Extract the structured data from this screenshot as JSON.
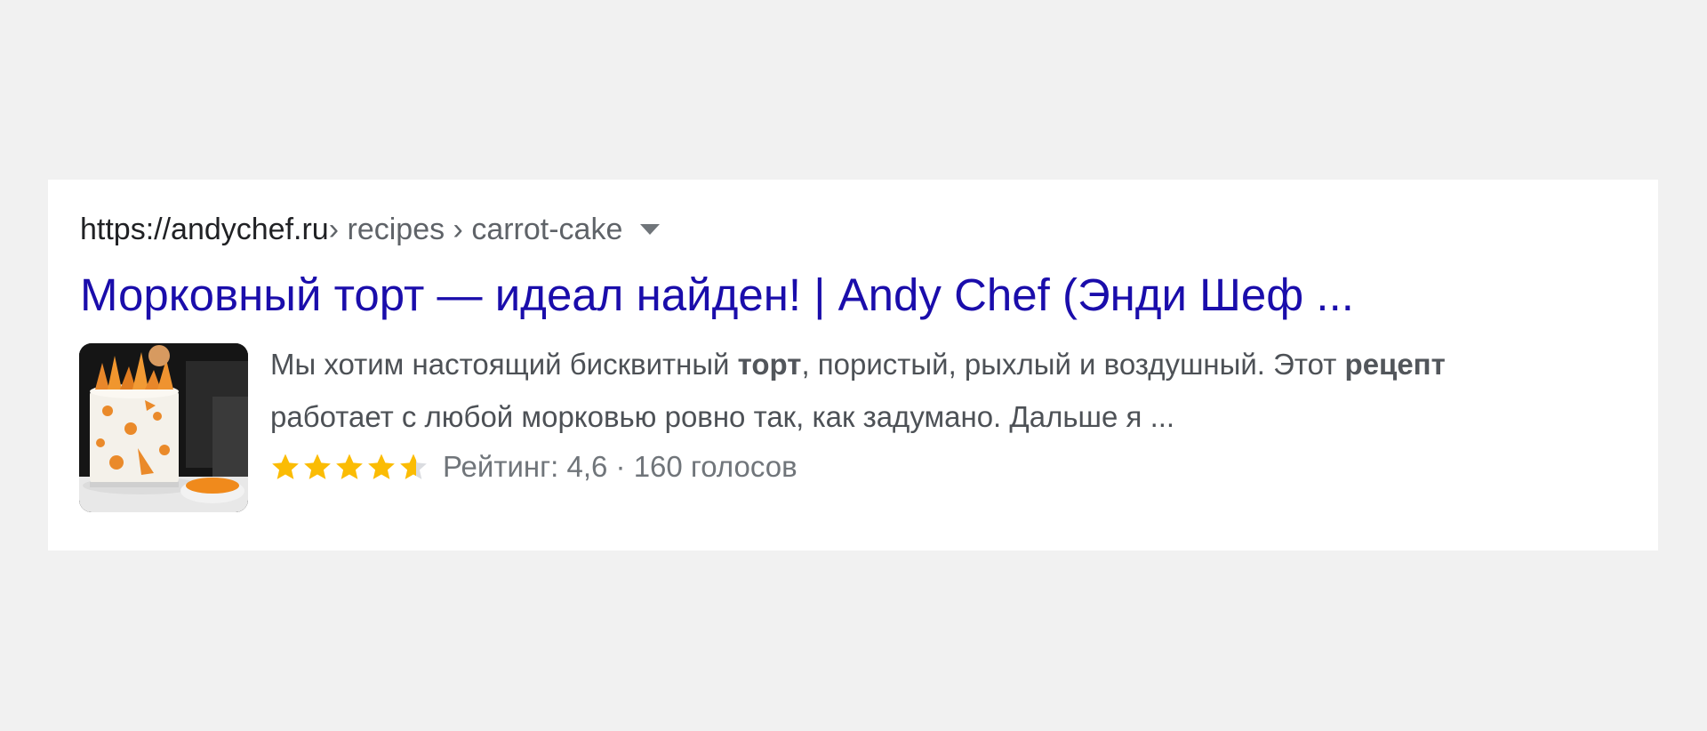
{
  "result": {
    "breadcrumb": {
      "domain": "https://andychef.ru",
      "path": " › recipes › carrot-cake"
    },
    "title": "Морковный торт — идеал найден! | Andy Chef (Энди Шеф ...",
    "snippet": {
      "part1": "Мы хотим настоящий бисквитный ",
      "bold1": "торт",
      "part2": ", пористый, рыхлый и воздушный. Этот ",
      "bold2": "рецепт",
      "part3": " работает с любой морковью ровно так, как задумано. Дальше я ..."
    },
    "rating": {
      "value": 4.6,
      "max": 5,
      "text": "Рейтинг: 4,6 · 160 голосов"
    }
  },
  "colors": {
    "page_background": "#f1f1f1",
    "card_background": "#ffffff",
    "link": "#1a0dab",
    "star_fill": "#fbbc04",
    "star_empty": "#dadce0"
  },
  "icons": {
    "caret": "triangle-down",
    "stars": "star-rating"
  }
}
